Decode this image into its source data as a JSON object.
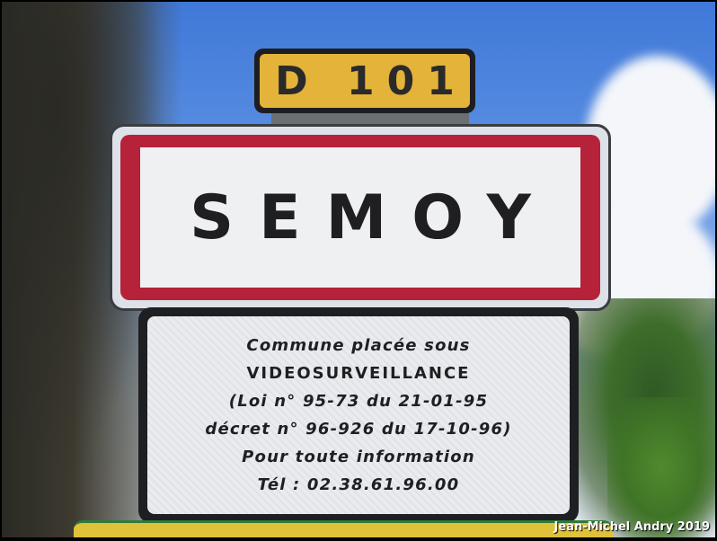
{
  "route_sign": {
    "text": "D 101"
  },
  "town_sign": {
    "name": "SEMOY"
  },
  "info_sign": {
    "lines": [
      "Commune placée sous",
      "VIDEOSURVEILLANCE",
      "(Loi n° 95-73 du 21-01-95",
      "décret n° 96-926 du 17-10-96)",
      "Pour toute information",
      "Tél : 02.38.61.96.00"
    ]
  },
  "credit": "Jean-Michel Andry 2019",
  "colors": {
    "route_sign_yellow": "#e3b33a",
    "town_sign_red": "#b5223a",
    "sky_blue": "#4a82dc"
  }
}
